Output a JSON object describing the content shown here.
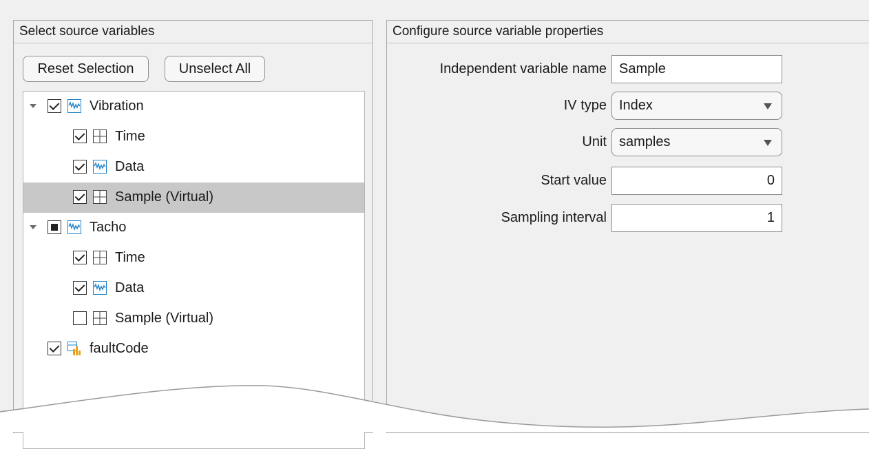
{
  "left_panel": {
    "title": "Select source variables",
    "reset_button": "Reset Selection",
    "unselect_button": "Unselect All",
    "tree": [
      {
        "label": "Vibration",
        "checked": "checked",
        "expanded": true,
        "icon": "signal-icon",
        "level": 0
      },
      {
        "label": "Time",
        "checked": "checked",
        "icon": "table-icon",
        "level": 1
      },
      {
        "label": "Data",
        "checked": "checked",
        "icon": "signal-icon",
        "level": 1
      },
      {
        "label": "Sample (Virtual)",
        "checked": "checked",
        "icon": "table-icon",
        "level": 1,
        "selected": true
      },
      {
        "label": "Tacho",
        "checked": "partial",
        "expanded": true,
        "icon": "signal-icon",
        "level": 0
      },
      {
        "label": "Time",
        "checked": "checked",
        "icon": "table-icon",
        "level": 1
      },
      {
        "label": "Data",
        "checked": "checked",
        "icon": "signal-icon",
        "level": 1
      },
      {
        "label": "Sample (Virtual)",
        "checked": "unchecked",
        "icon": "table-icon",
        "level": 1
      },
      {
        "label": "faultCode",
        "checked": "checked",
        "icon": "categorical-icon",
        "level": 0
      }
    ]
  },
  "right_panel": {
    "title": "Configure source variable properties",
    "iv_name_label": "Independent variable name",
    "iv_name_value": "Sample",
    "iv_type_label": "IV type",
    "iv_type_value": "Index",
    "unit_label": "Unit",
    "unit_value": "samples",
    "start_label": "Start value",
    "start_value": "0",
    "interval_label": "Sampling interval",
    "interval_value": "1"
  },
  "colors": {
    "selection": "#c8c8c8",
    "signal_icon": "#1f82c9",
    "categorical_icon": "#e8a317"
  }
}
